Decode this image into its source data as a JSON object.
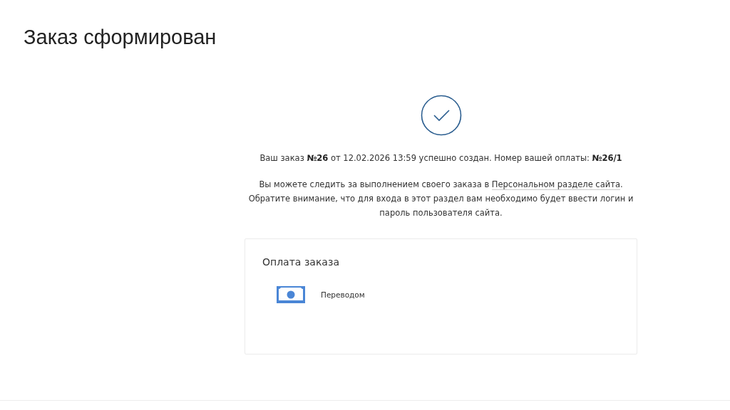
{
  "page": {
    "title": "Заказ сформирован"
  },
  "confirmation": {
    "summary": "Ваш заказ **№26** от 12.02.2026 13:59 успешно создан. Номер вашей оплаты: **№26/1**",
    "info_before": "Вы можете следить за выполнением своего заказа в ",
    "info_link": "Персональном разделе сайта",
    "info_after": ". Обратите внимание, что для входа в этот раздел вам необходимо будет ввести логин и пароль пользователя сайта."
  },
  "payment": {
    "title": "Оплата заказа",
    "methods": [
      {
        "kind": "cash",
        "label": "Переводом"
      }
    ]
  }
}
